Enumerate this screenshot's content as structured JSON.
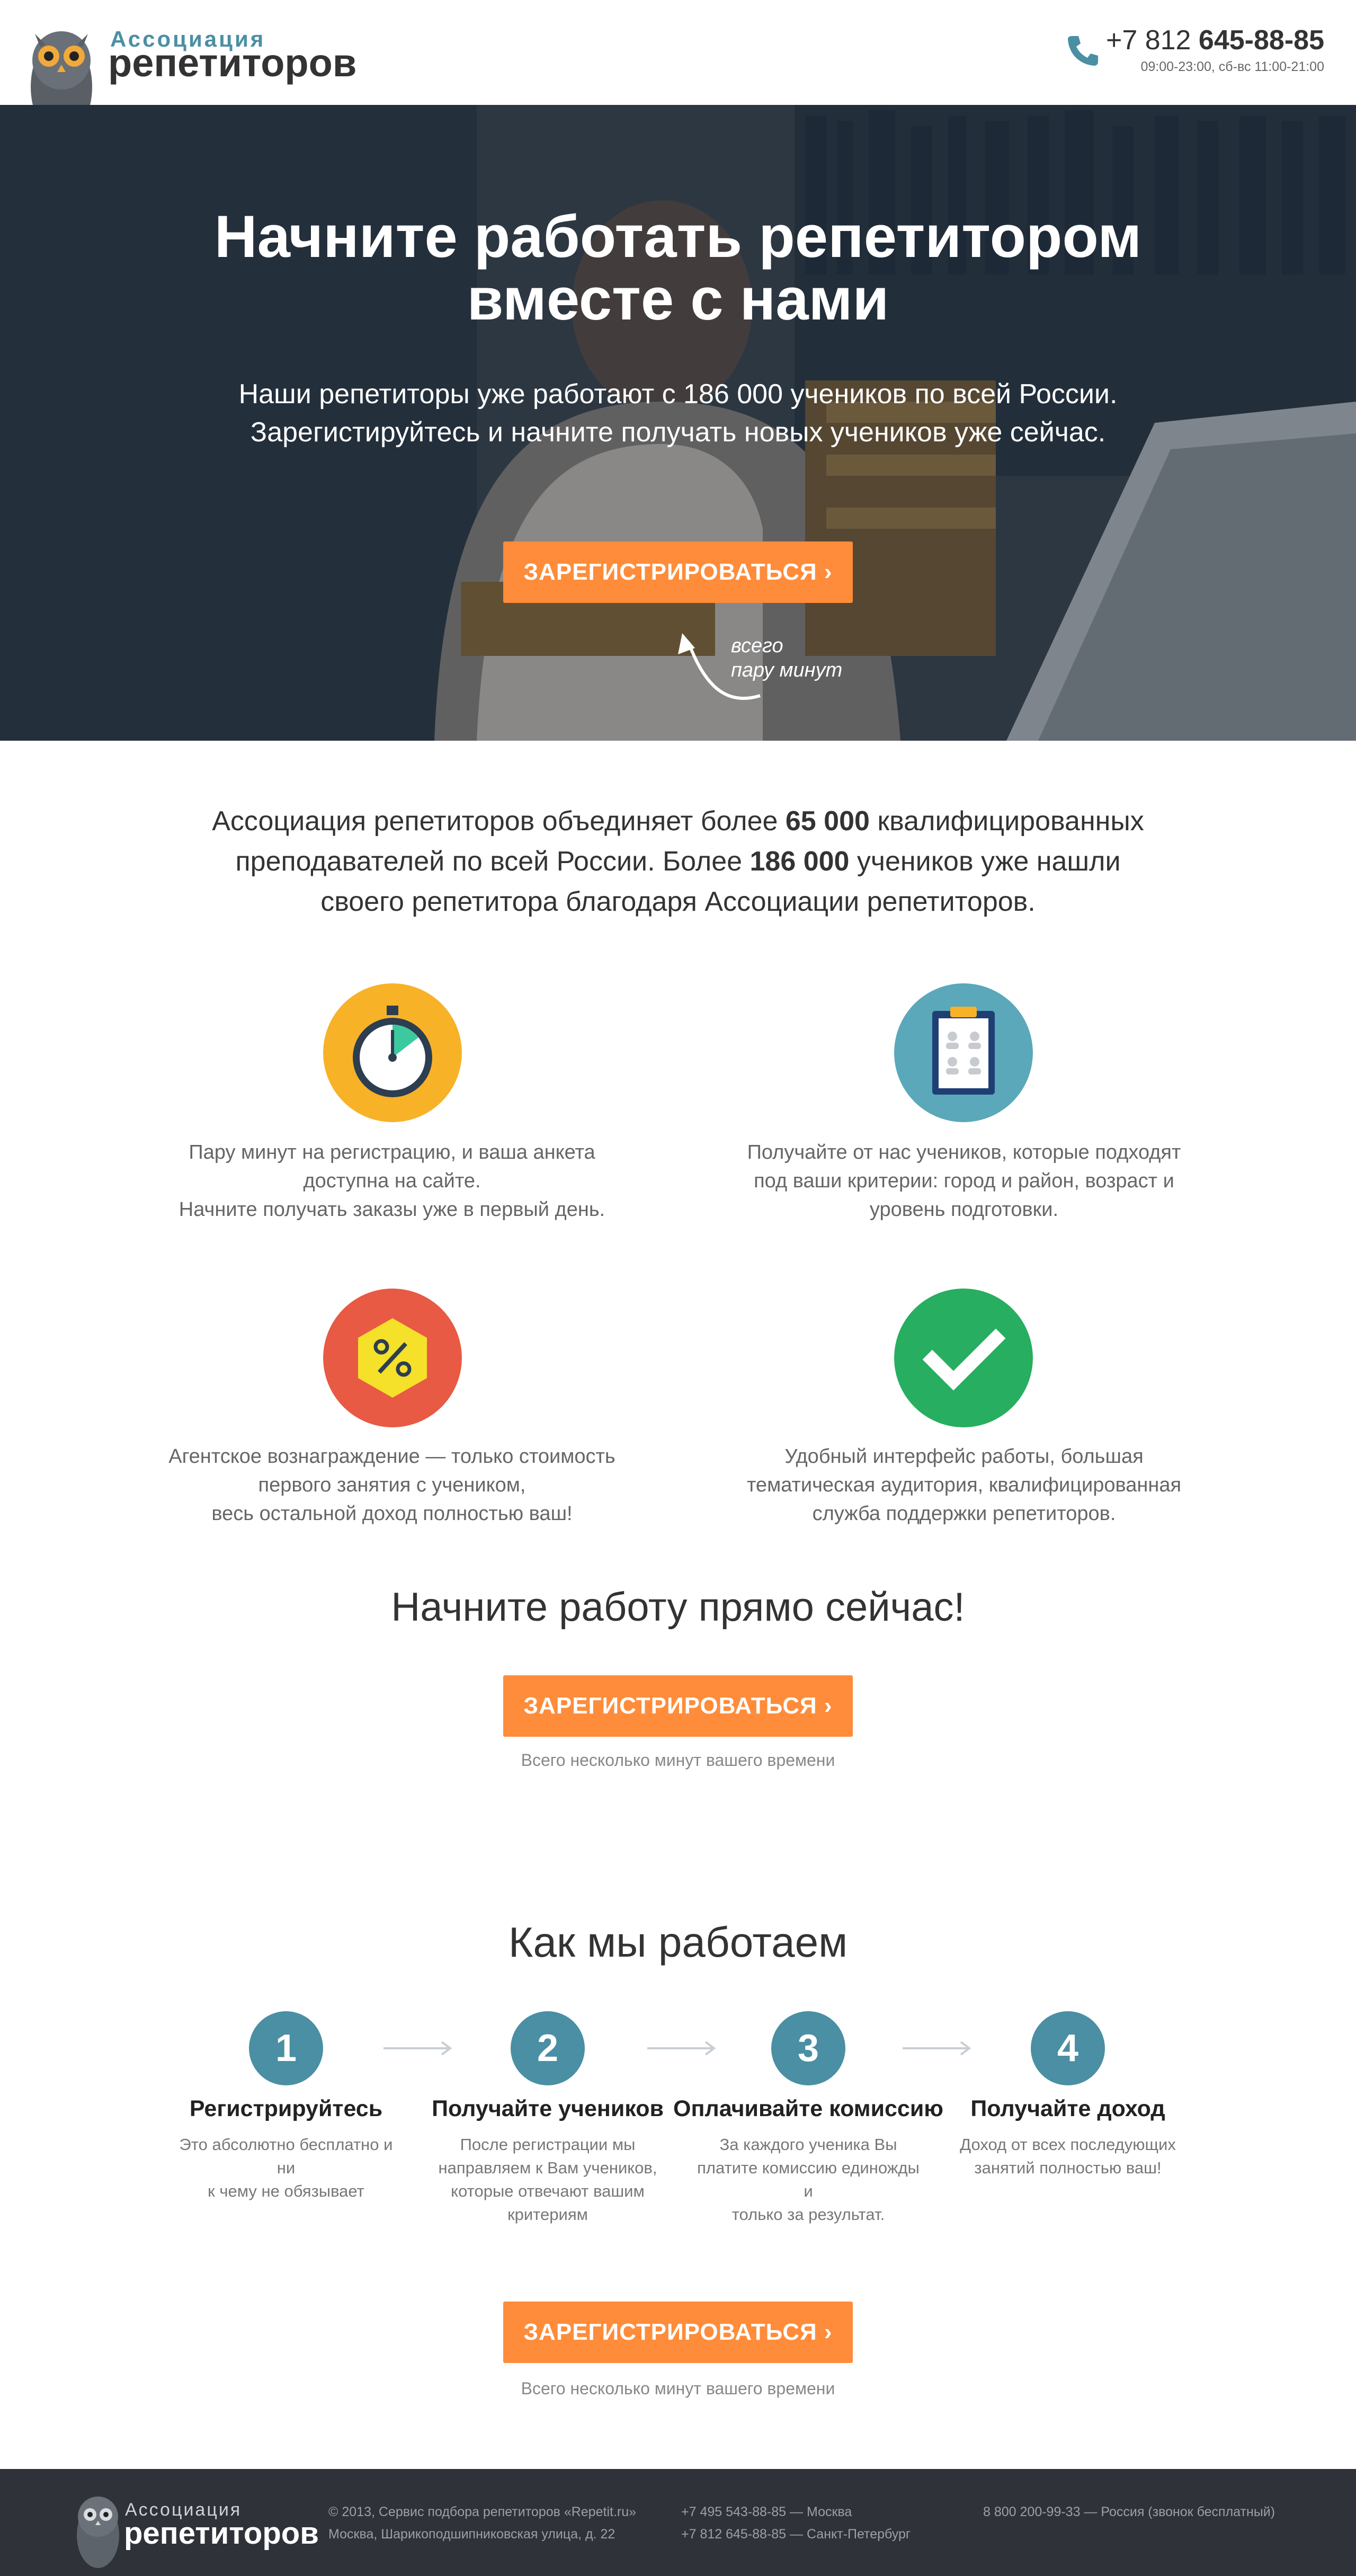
{
  "header": {
    "logo_small": "Ассоциация",
    "logo_big": "репетиторов",
    "phone_prefix": "+7 812 ",
    "phone_number": "645-88-85",
    "hours": "09:00-23:00, сб-вс 11:00-21:00"
  },
  "hero": {
    "title_line1": "Начните работать репетитором",
    "title_line2": "вместе с нами",
    "subtitle_line1": "Наши репетиторы уже работают с 186 000 учеников по всей России.",
    "subtitle_line2": "Зарегистируйтесь и начните получать новых учеников уже сейчас.",
    "button": "ЗАРЕГИСТРИРОВАТЬСЯ  ›",
    "note_line1": "всего",
    "note_line2": "пару минут"
  },
  "intro": {
    "p1": "Ассоциация репетиторов объединяет более ",
    "n1": "65 000",
    "p2": " квалифицированных",
    "line2a": "преподавателей по всей России. Более ",
    "n2": "186 000",
    "line2b": " учеников уже нашли",
    "line3": "своего репетитора благодаря Ассоциации репетиторов."
  },
  "features": [
    {
      "icon": "stopwatch-icon",
      "color": "#f7b228",
      "lines": [
        "Пару минут на регистрацию, и ваша анкета",
        "доступна на сайте.",
        "Начните получать заказы уже в первый день."
      ]
    },
    {
      "icon": "clipboard-icon",
      "color": "#5aa8b9",
      "lines": [
        "Получайте от нас учеников, которые подходят",
        "под ваши критерии: город и район, возраст и",
        "уровень подготовки."
      ]
    },
    {
      "icon": "percent-icon",
      "color": "#e85a44",
      "lines": [
        "Агентское вознаграждение — только стоимость",
        "первого занятия с учеником,",
        "весь остальной доход полностью ваш!"
      ]
    },
    {
      "icon": "checkmark-icon",
      "color": "#27ae60",
      "lines": [
        "Удобный интерфейс работы, большая",
        "тематическая аудитория, квалифицированная",
        "служба поддержки репетиторов."
      ]
    }
  ],
  "cta": {
    "title": "Начните работу прямо сейчас!",
    "button": "ЗАРЕГИСТРИРОВАТЬСЯ  ›",
    "note": "Всего несколько минут вашего времени"
  },
  "how": {
    "title": "Как мы работаем",
    "steps": [
      {
        "num": "1",
        "title": "Регистрируйтесь",
        "lines": [
          "Это абсолютно бесплатно и ни",
          "к чему не обязывает"
        ]
      },
      {
        "num": "2",
        "title": "Получайте учеников",
        "lines": [
          "После регистрации мы",
          "направляем к Вам учеников,",
          "которые отвечают вашим",
          "критериям"
        ]
      },
      {
        "num": "3",
        "title": "Оплачивайте комиссию",
        "lines": [
          "За каждого ученика Вы",
          "платите комиссию единожды и",
          "только за результат."
        ]
      },
      {
        "num": "4",
        "title": "Получайте доход",
        "lines": [
          "Доход от всех последующих",
          "занятий полностью ваш!"
        ]
      }
    ],
    "button": "ЗАРЕГИСТРИРОВАТЬСЯ  ›",
    "note": "Всего несколько минут вашего времени"
  },
  "footer": {
    "logo_small": "Ассоциация",
    "logo_big": "репетиторов",
    "copyright": "© 2013, Сервис подбора репетиторов «Repetit.ru»",
    "address": "Москва, Шарикоподшипниковская улица, д. 22",
    "phone_msk": "+7 495 543-88-85 — Москва",
    "phone_spb": "+7 812 645-88-85 — Санкт-Петербург",
    "phone_free": "8 800 200-99-33 — Россия (звонок бесплатный)"
  },
  "colors": {
    "accent_orange": "#ff8c3a",
    "brand_teal": "#4a8fa3",
    "footer_bg": "#2f3339"
  }
}
